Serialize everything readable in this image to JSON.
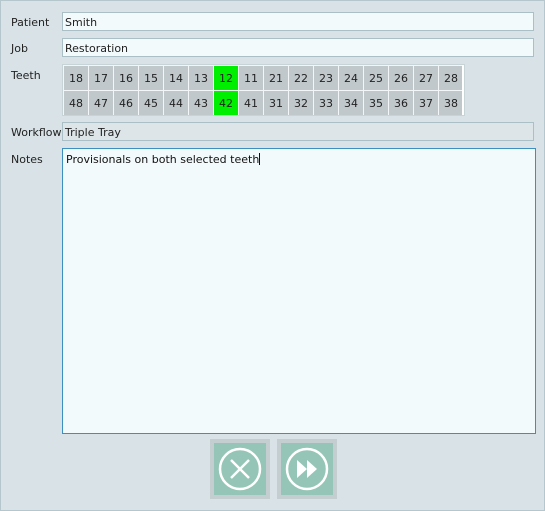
{
  "form": {
    "patient_label": "Patient",
    "patient_value": "Smith",
    "job_label": "Job",
    "job_value": "Restoration",
    "teeth_label": "Teeth",
    "workflow_label": "Workflow",
    "workflow_value": "Triple Tray",
    "notes_label": "Notes",
    "notes_value": "Provisionals on both selected teeth"
  },
  "teeth": {
    "upper": [
      "18",
      "17",
      "16",
      "15",
      "14",
      "13",
      "12",
      "11",
      "21",
      "22",
      "23",
      "24",
      "25",
      "26",
      "27",
      "28"
    ],
    "lower": [
      "48",
      "47",
      "46",
      "45",
      "44",
      "43",
      "42",
      "41",
      "31",
      "32",
      "33",
      "34",
      "35",
      "36",
      "37",
      "38"
    ],
    "selected": [
      "12",
      "42"
    ],
    "selected_color": "#00ee00",
    "default_color": "#c1c8cb"
  },
  "buttons": {
    "cancel_icon": "close-circle-icon",
    "next_icon": "fast-forward-circle-icon",
    "accent": "#95c5b6"
  }
}
